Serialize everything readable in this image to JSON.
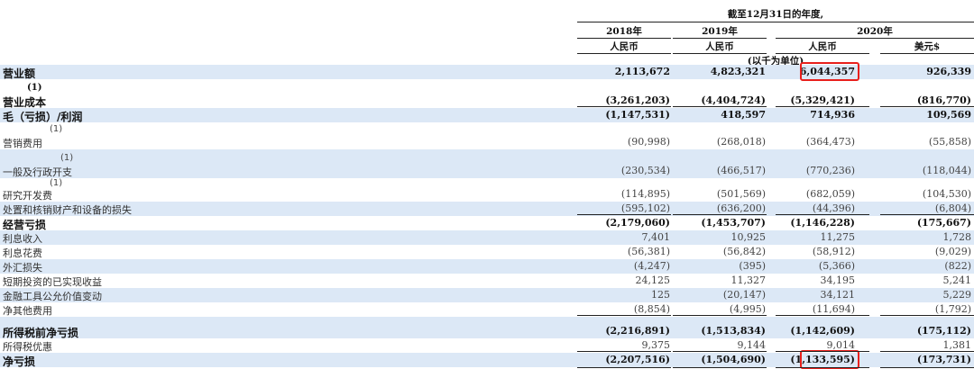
{
  "header": {
    "period": "截至12月31日的年度,",
    "years": [
      "2018年",
      "2019年",
      "2020年"
    ],
    "currencies": [
      "人民币",
      "人民币",
      "人民币",
      "美元$"
    ],
    "unit_note": "(以千为单位)"
  },
  "rows": [
    {
      "label": "营业额",
      "sup": "",
      "bold": true,
      "shade": true,
      "values": [
        "2,113,672",
        "4,823,321",
        "6,044,357",
        "926,339"
      ],
      "highlight": true
    },
    {
      "label": "营业成本",
      "sup": "(1)",
      "bold": true,
      "shade": false,
      "values": [
        "(3,261,203)",
        "(4,404,724)",
        "(5,329,421)",
        "(816,770)"
      ]
    },
    {
      "label": "毛（亏损）/利润",
      "sup": "",
      "bold": true,
      "shade": true,
      "values": [
        "(1,147,531)",
        "418,597",
        "714,936",
        "109,569"
      ]
    },
    {
      "label": "营销费用",
      "sup": "(1)",
      "bold": false,
      "shade": false,
      "values": [
        "(90,998)",
        "(268,018)",
        "(364,473)",
        "(55,858)"
      ]
    },
    {
      "label": "一般及行政开支",
      "sup": "(1)",
      "bold": false,
      "shade": true,
      "values": [
        "(230,534)",
        "(466,517)",
        "(770,236)",
        "(118,044)"
      ]
    },
    {
      "label": "研究开发费",
      "sup": "(1)",
      "bold": false,
      "shade": false,
      "values": [
        "(114,895)",
        "(501,569)",
        "(682,059)",
        "(104,530)"
      ]
    },
    {
      "label": "处置和核销财产和设备的损失",
      "sup": "",
      "bold": false,
      "shade": true,
      "values": [
        "(595,102)",
        "(636,200)",
        "(44,396)",
        "(6,804)"
      ]
    },
    {
      "label": "经营亏损",
      "sup": "",
      "bold": true,
      "shade": false,
      "values": [
        "(2,179,060)",
        "(1,453,707)",
        "(1,146,228)",
        "(175,667)"
      ]
    },
    {
      "label": "利息收入",
      "sup": "",
      "bold": false,
      "shade": true,
      "values": [
        "7,401",
        "10,925",
        "11,275",
        "1,728"
      ]
    },
    {
      "label": "利息花费",
      "sup": "",
      "bold": false,
      "shade": false,
      "values": [
        "(56,381)",
        "(56,842)",
        "(58,912)",
        "(9,029)"
      ]
    },
    {
      "label": "外汇损失",
      "sup": "",
      "bold": false,
      "shade": true,
      "values": [
        "(4,247)",
        "(395)",
        "(5,366)",
        "(822)"
      ]
    },
    {
      "label": "短期投资的已实现收益",
      "sup": "",
      "bold": false,
      "shade": false,
      "values": [
        "24,125",
        "11,327",
        "34,195",
        "5,241"
      ]
    },
    {
      "label": "金融工具公允价值变动",
      "sup": "",
      "bold": false,
      "shade": true,
      "values": [
        "125",
        "(20,147)",
        "34,121",
        "5,229"
      ]
    },
    {
      "label": "净其他费用",
      "sup": "",
      "bold": false,
      "shade": false,
      "values": [
        "(8,854)",
        "(4,995)",
        "(11,694)",
        "(1,792)"
      ]
    },
    {
      "label": "所得税前净亏损",
      "sup": "",
      "bold": true,
      "shade": true,
      "values": [
        "(2,216,891)",
        "(1,513,834)",
        "(1,142,609)",
        "(175,112)"
      ]
    },
    {
      "label": "所得税优惠",
      "sup": "",
      "bold": false,
      "shade": false,
      "values": [
        "9,375",
        "9,144",
        "9,014",
        "1,381"
      ]
    },
    {
      "label": "净亏损",
      "sup": "",
      "bold": true,
      "shade": true,
      "values": [
        "(2,207,516)",
        "(1,504,690)",
        "(1,133,595)",
        "(173,731)"
      ],
      "highlight": true
    }
  ],
  "colors": {
    "shade": "#dce8f6",
    "highlight": "#e8201c"
  }
}
